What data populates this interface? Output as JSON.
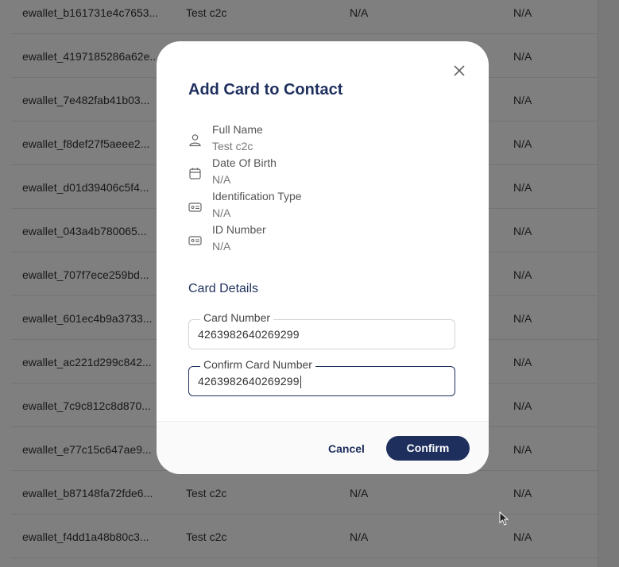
{
  "table": {
    "rows": [
      {
        "id": "ewallet_b161731e4c7653...",
        "name": "Test c2c",
        "col3": "N/A",
        "col4": "N/A"
      },
      {
        "id": "ewallet_4197185286a62e...",
        "name": "",
        "col3": "",
        "col4": "N/A"
      },
      {
        "id": "ewallet_7e482fab41b03...",
        "name": "",
        "col3": "",
        "col4": "N/A"
      },
      {
        "id": "ewallet_f8def27f5aeee2...",
        "name": "",
        "col3": "",
        "col4": "N/A"
      },
      {
        "id": "ewallet_d01d39406c5f4...",
        "name": "",
        "col3": "",
        "col4": "N/A"
      },
      {
        "id": "ewallet_043a4b780065...",
        "name": "",
        "col3": "",
        "col4": "N/A"
      },
      {
        "id": "ewallet_707f7ece259bd...",
        "name": "",
        "col3": "",
        "col4": "N/A"
      },
      {
        "id": "ewallet_601ec4b9a3733...",
        "name": "",
        "col3": "",
        "col4": "N/A"
      },
      {
        "id": "ewallet_ac221d299c842...",
        "name": "",
        "col3": "",
        "col4": "N/A"
      },
      {
        "id": "ewallet_7c9c812c8d870...",
        "name": "",
        "col3": "",
        "col4": "N/A"
      },
      {
        "id": "ewallet_e77c15c647ae9...",
        "name": "",
        "col3": "",
        "col4": "N/A"
      },
      {
        "id": "ewallet_b87148fa72fde6...",
        "name": "Test c2c",
        "col3": "N/A",
        "col4": "N/A"
      },
      {
        "id": "ewallet_f4dd1a48b80c3...",
        "name": "Test c2c",
        "col3": "N/A",
        "col4": "N/A"
      }
    ]
  },
  "modal": {
    "title": "Add Card to Contact",
    "info": [
      {
        "label": "Full Name",
        "value": "Test c2c",
        "icon": "person-icon"
      },
      {
        "label": "Date Of Birth",
        "value": "N/A",
        "icon": "calendar-icon"
      },
      {
        "label": "Identification Type",
        "value": "N/A",
        "icon": "id-card-icon"
      },
      {
        "label": "ID Number",
        "value": "N/A",
        "icon": "id-card-icon"
      }
    ],
    "section_title": "Card Details",
    "card_number": {
      "label": "Card Number",
      "value": "4263982640269299"
    },
    "confirm_card_number": {
      "label": "Confirm Card Number",
      "value": "4263982640269299"
    },
    "cancel_label": "Cancel",
    "confirm_label": "Confirm"
  },
  "colors": {
    "accent": "#1e2f5e",
    "overlay": "rgba(0,0,0,0.5)"
  }
}
